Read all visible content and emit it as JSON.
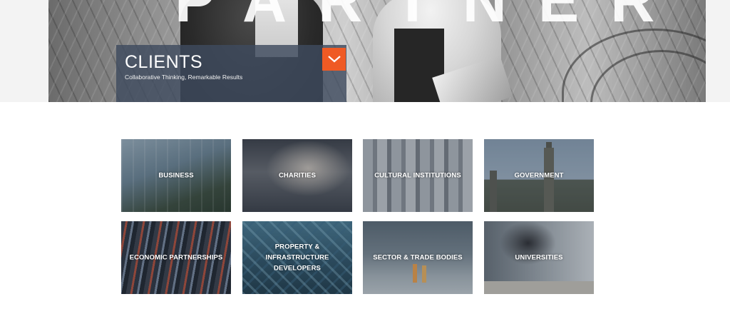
{
  "hero": {
    "background_text": "PARTNERS",
    "title": "CLIENTS",
    "subtitle": "Collaborative Thinking, Remarkable Results",
    "toggle_icon": "chevron-down-icon"
  },
  "colors": {
    "accent": "#ef5a24",
    "panel": "#3e4a5e",
    "tile_overlay": "#232d3c"
  },
  "clients": {
    "tiles": [
      {
        "label": "BUSINESS"
      },
      {
        "label": "CHARITIES"
      },
      {
        "label": "CULTURAL INSTITUTIONS"
      },
      {
        "label": "GOVERNMENT"
      },
      {
        "label": "ECONOMIC PARTNERSHIPS"
      },
      {
        "label": "PROPERTY & INFRASTRUCTURE DEVELOPERS"
      },
      {
        "label": "SECTOR & TRADE BODIES"
      },
      {
        "label": "UNIVERSITIES"
      }
    ]
  }
}
